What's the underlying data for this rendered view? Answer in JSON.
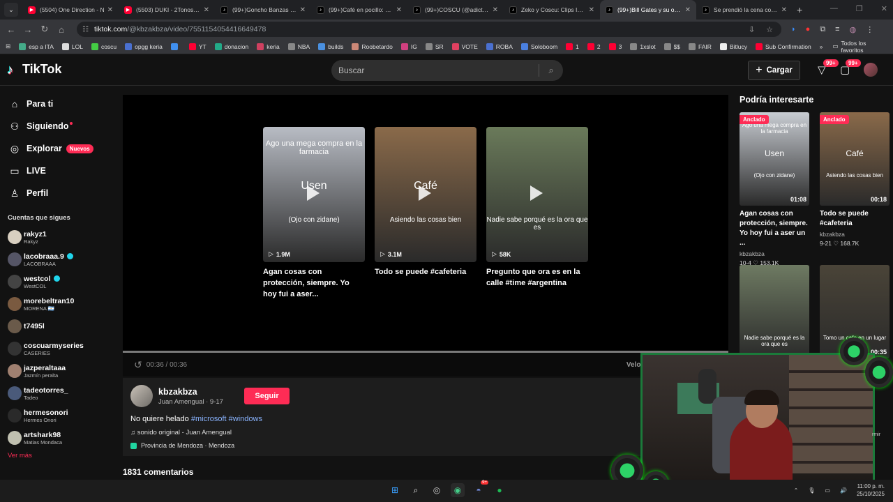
{
  "browser": {
    "tabs": [
      {
        "title": "(5504) One Direction - N",
        "icon": "youtube-icon",
        "active": false
      },
      {
        "title": "(5503) DUKI - 2Tonos (Vi",
        "icon": "youtube-icon",
        "active": false
      },
      {
        "title": "(99+)Goncho Banzas en C",
        "icon": "tiktok-icon",
        "active": false
      },
      {
        "title": "(99+)Café en pocillo: opc",
        "icon": "tiktok-icon",
        "active": false
      },
      {
        "title": "(99+)COSCU (@adictoalv",
        "icon": "tiktok-icon",
        "active": false
      },
      {
        "title": "Zeko y Coscu: Clips Impe",
        "icon": "tiktok-icon",
        "active": false
      },
      {
        "title": "(99+)Bill Gates y su opini",
        "icon": "tiktok-icon",
        "active": true
      },
      {
        "title": "Se prendió la cena con V",
        "icon": "tiktok-icon",
        "active": false
      }
    ],
    "url_host": "tiktok.com",
    "url_path": "/@kbzakbza/video/7551154054416649478",
    "bookmarks": [
      "esp a ITA",
      "LOL",
      "coscu",
      "opgg keria",
      "",
      "YT",
      "donacion",
      "keria",
      "NBA",
      "builds",
      "Roobetardo",
      "IG",
      "SR",
      "VOTE",
      "ROBA",
      "Soloboom",
      "1",
      "2",
      "3",
      "1xslot",
      "$$",
      "FAIR",
      "Bitlucy",
      "Sub Confirmation"
    ],
    "bookmarks_folder": "Todos los favoritos"
  },
  "header": {
    "logo": "TikTok",
    "search_placeholder": "Buscar",
    "upload_label": "Cargar",
    "inbox_badge": "99+",
    "messages_badge": "99+"
  },
  "sidebar": {
    "nav": [
      {
        "label": "Para ti",
        "icon": "home-icon"
      },
      {
        "label": "Siguiendo",
        "icon": "following-icon",
        "dot": true
      },
      {
        "label": "Explorar",
        "icon": "compass-icon",
        "pill": "Nuevos"
      },
      {
        "label": "LIVE",
        "icon": "live-icon"
      },
      {
        "label": "Perfil",
        "icon": "profile-icon"
      }
    ],
    "following_title": "Cuentas que sigues",
    "following": [
      {
        "name": "rakyz1",
        "sub": "Rakyz",
        "verified": false,
        "color": "#d8cfc0"
      },
      {
        "name": "lacobraaa.9",
        "sub": "LACOBRAAA",
        "verified": true,
        "color": "#556"
      },
      {
        "name": "westcol",
        "sub": "WestCOL",
        "verified": true,
        "color": "#444"
      },
      {
        "name": "morebeltran10",
        "sub": "MORENA 🇦🇷",
        "verified": false,
        "color": "#7a5a40"
      },
      {
        "name": "t7495l",
        "sub": "",
        "verified": false,
        "color": "#6a5a4a"
      },
      {
        "name": "coscuarmyseries",
        "sub": "CASERIES",
        "verified": false,
        "color": "#333"
      },
      {
        "name": "jazperaltaaa",
        "sub": "Jazmín peralta",
        "verified": false,
        "color": "#a08070"
      },
      {
        "name": "tadeotorres_",
        "sub": "Tadeo",
        "verified": false,
        "color": "#4a5a7a"
      },
      {
        "name": "hermesonori",
        "sub": "Hermes Onori",
        "verified": false,
        "color": "#2a2a2a"
      },
      {
        "name": "artshark98",
        "sub": "Matias Mondaca",
        "verified": false,
        "color": "#c0c0b0"
      }
    ],
    "more": "Ver más"
  },
  "player": {
    "related": [
      {
        "overlay": "Ago una mega compra en la farmacia",
        "big": "Usen",
        "mid": "(Ojo con zidane)",
        "views": "1.9M",
        "caption": "Agan cosas con protección, siempre. Yo hoy fui a aser...",
        "bg": "#b8bcc4"
      },
      {
        "overlay": "",
        "big": "Café",
        "mid": "Asiendo las cosas bien",
        "views": "3.1M",
        "caption": "Todo se puede #cafeteria",
        "bg": "#8a6a4a"
      },
      {
        "overlay": "",
        "big": "",
        "mid": "Nadie sabe porqué es la ora que es",
        "views": "58K",
        "caption": "Pregunto que ora es en la calle #time #argentina",
        "bg": "#6a7a5a"
      }
    ],
    "time": "00:36 / 00:36",
    "progress": 1.0,
    "speed_label": "Veloc"
  },
  "author": {
    "username": "kbzakbza",
    "subline": "Juan Amengual · 9-17",
    "follow_label": "Seguir",
    "desc_text": "No quiere helado ",
    "tags": [
      "#microsoft",
      "#windows"
    ],
    "sound": "♫ sonido original - Juan Amengual",
    "location": "Provincia de Mendoza · Mendoza"
  },
  "comments": "1831 comentarios",
  "right": {
    "title": "Podría interesarte",
    "cards": [
      {
        "pinned": "Anclado",
        "duration": "01:08",
        "caption": "Agan cosas con protección, siempre. Yo hoy fui a aser un ...",
        "user": "kbzakbza",
        "date": "10-4",
        "likes": "153.1K",
        "bg": "#c8ccd2",
        "ov_top": "Ago una mega compra en la farmacia",
        "ov_mid": "Usen",
        "ov_low": "(Ojo con zidane)"
      },
      {
        "pinned": "Anclado",
        "duration": "00:18",
        "caption": "Todo se puede #cafeteria",
        "user": "kbzakbza",
        "date": "9-21",
        "likes": "168.7K",
        "bg": "#8a6a4a",
        "ov_top": "",
        "ov_mid": "Café",
        "ov_low": "Asiendo las cosas bien"
      },
      {
        "pinned": "",
        "duration": "",
        "caption": "",
        "user": "",
        "date": "",
        "likes": "",
        "bg": "#6e7a62",
        "ov_top": "",
        "ov_mid": "",
        "ov_low": "Nadie sabe porqué es la ora que es"
      },
      {
        "pinned": "",
        "duration": "00:35",
        "caption": "",
        "user": "",
        "date": "",
        "likes": "",
        "bg": "#4a4438",
        "ov_top": "",
        "ov_mid": "",
        "ov_low": "Tomo un cafe en un lugar original"
      }
    ]
  },
  "webcam": {
    "side_text": "rmir"
  },
  "taskbar": {
    "time": "11:00 p. m.",
    "date": "25/10/2025",
    "discord_badge": "9+"
  }
}
